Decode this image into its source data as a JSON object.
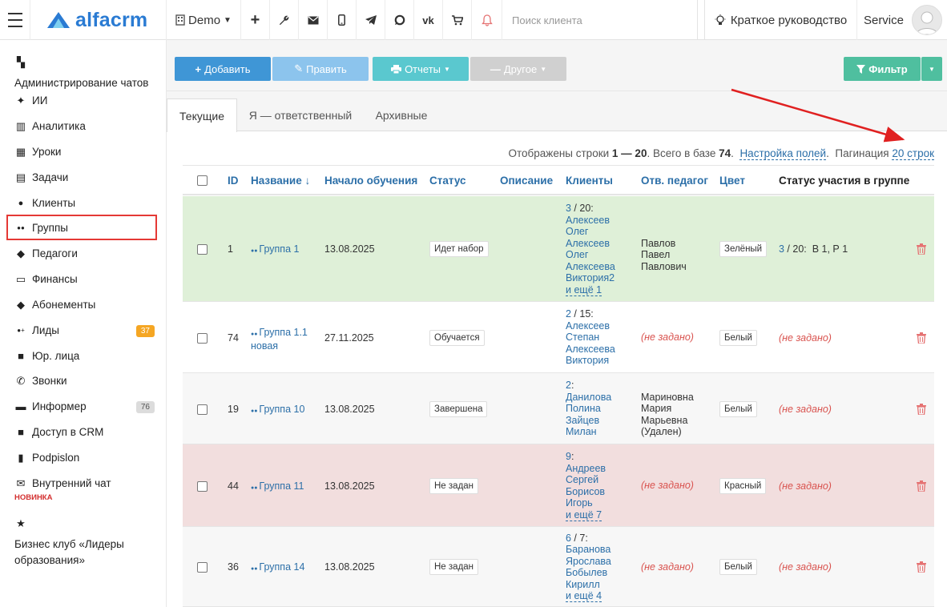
{
  "topbar": {
    "logo": "alfacrm",
    "branch": "Demo",
    "search_placeholder": "Поиск клиента",
    "guide": "Краткое руководство",
    "user": "Service"
  },
  "sidebar": {
    "items": [
      {
        "icon": "chat-admin-icon",
        "label": "Администрирование чатов"
      },
      {
        "icon": "sparkles-icon",
        "label": "ИИ"
      },
      {
        "icon": "map-icon",
        "label": "Аналитика"
      },
      {
        "icon": "calendar-icon",
        "label": "Уроки"
      },
      {
        "icon": "clipboard-icon",
        "label": "Задачи"
      },
      {
        "icon": "user-icon",
        "label": "Клиенты"
      },
      {
        "icon": "users-icon",
        "label": "Группы"
      },
      {
        "icon": "graduation-cap-icon",
        "label": "Педагоги"
      },
      {
        "icon": "money-icon",
        "label": "Финансы"
      },
      {
        "icon": "tag-icon",
        "label": "Абонементы"
      },
      {
        "icon": "user-plus-icon",
        "label": "Лиды",
        "badge": "37"
      },
      {
        "icon": "briefcase-icon",
        "label": "Юр. лица"
      },
      {
        "icon": "phone-icon",
        "label": "Звонки"
      },
      {
        "icon": "informer-icon",
        "label": "Информер",
        "badge": "76"
      },
      {
        "icon": "lock-icon",
        "label": "Доступ в CRM"
      },
      {
        "icon": "file-icon",
        "label": "Podpislon"
      },
      {
        "icon": "envelope-icon",
        "label": "Внутренний чат",
        "note": "НОВИНКА"
      },
      {
        "icon": "star-icon",
        "label": "Бизнес клуб «Лидеры образования»"
      }
    ],
    "badge_colors": {
      "leads": "#f5a623",
      "informer": "#dcdcdc"
    }
  },
  "toolbar": {
    "add": "Добавить",
    "edit": "Править",
    "reports": "Отчеты",
    "other": "Другое",
    "filter": "Фильтр"
  },
  "tabs": [
    "Текущие",
    "Я — ответственный",
    "Архивные"
  ],
  "info": {
    "prefix": "Отображены строки",
    "range": "1 — 20",
    "middle": ". Всего в базе",
    "total": "74",
    "dot": ".",
    "fields_link": "Настройка полей",
    "pagination_label": "Пагинация",
    "pagination_value": "20 строк"
  },
  "table": {
    "headers": [
      "ID",
      "Название ↓",
      "Начало обучения",
      "Статус",
      "Описание",
      "Клиенты",
      "Отв. педагог",
      "Цвет",
      "Статус участия в группе"
    ],
    "rows": [
      {
        "bg": "#dff0d8",
        "id": "1",
        "name": "Группа 1",
        "start": "13.08.2025",
        "status": "Идет набор",
        "clients_count": "3",
        "clients_max": " / 20:",
        "clients": [
          "Алексеев",
          "Олег",
          "Алексеев",
          "Олег",
          "Алексеева",
          "Виктория2"
        ],
        "clients_more": "и ещё 1",
        "teacher": "Павлов Павел Павлович",
        "color": "Зелёный",
        "participation_count": "3",
        "participation_rest": " / 20:  В 1, Р 1"
      },
      {
        "bg": "#ffffff",
        "id": "74",
        "name": "Группа 1.1 новая",
        "start": "27.11.2025",
        "status": "Обучается",
        "clients_count": "2",
        "clients_max": " / 15:",
        "clients": [
          "Алексеев",
          "Степан",
          "Алексеева",
          "Виктория"
        ],
        "clients_more": "",
        "teacher": "(не задано)",
        "color": "Белый",
        "participation": "(не задано)"
      },
      {
        "bg": "#f7f7f7",
        "id": "19",
        "name": "Группа 10",
        "start": "13.08.2025",
        "status": "Завершена",
        "clients_count": "2",
        "clients_max": ":",
        "clients": [
          "Данилова",
          "Полина",
          "Зайцев",
          "Милан"
        ],
        "clients_more": "",
        "teacher": "Мариновна Мария Марьевна (Удален)",
        "color": "Белый",
        "participation": "(не задано)"
      },
      {
        "bg": "#f2dede",
        "id": "44",
        "name": "Группа 11",
        "start": "13.08.2025",
        "status": "Не задан",
        "clients_count": "9",
        "clients_max": ":",
        "clients": [
          "Андреев",
          "Сергей",
          "Борисов",
          "Игорь"
        ],
        "clients_more": "и ещё 7",
        "teacher": "(не задано)",
        "color": "Красный",
        "participation": "(не задано)"
      },
      {
        "bg": "#f7f7f7",
        "id": "36",
        "name": "Группа 14",
        "start": "13.08.2025",
        "status": "Не задан",
        "clients_count": "6",
        "clients_max": " / 7:",
        "clients": [
          "Баранова",
          "Ярослава",
          "Бобылев",
          "Кирилл"
        ],
        "clients_more": "и ещё 4",
        "teacher": "(не задано)",
        "color": "Белый",
        "participation": "(не задано)"
      }
    ]
  }
}
